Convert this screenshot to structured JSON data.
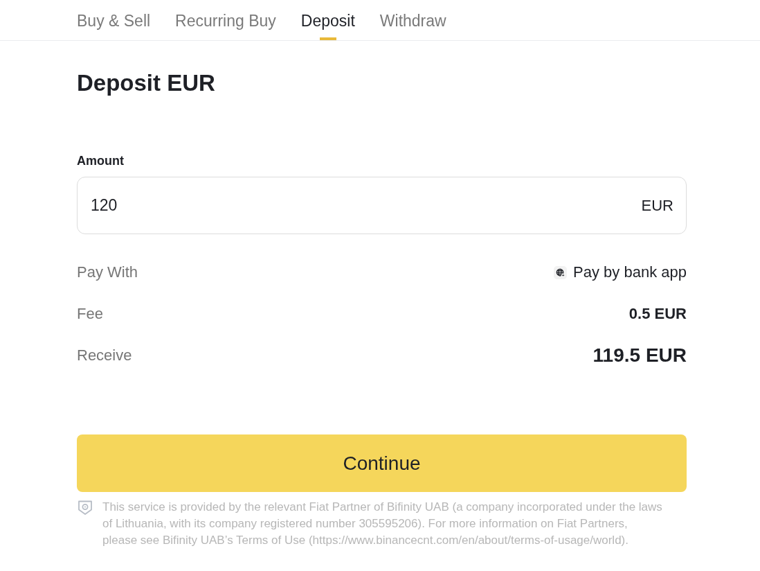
{
  "tabs": [
    {
      "label": "Buy & Sell",
      "selected": false
    },
    {
      "label": "Recurring Buy",
      "selected": false
    },
    {
      "label": "Deposit",
      "selected": true
    },
    {
      "label": "Withdraw",
      "selected": false
    }
  ],
  "title": "Deposit EUR",
  "amount": {
    "label": "Amount",
    "value": "120",
    "currency": "EUR"
  },
  "details": [
    {
      "kind": "method",
      "label": "Pay With",
      "value": "Pay by bank app"
    },
    {
      "kind": "plain",
      "label": "Fee",
      "value": "0.5 EUR"
    },
    {
      "kind": "total",
      "label": "Receive",
      "value": "119.5 EUR"
    }
  ],
  "continue_button": "Continue",
  "disclaimer": "This service is provided by the relevant Fiat Partner of Bifinity UAB (a company incorporated under the laws of Lithuania, with its company registered number 305595206). For more information on Fiat Partners, please see Bifinity UAB’s Terms of Use (https://www.binancecnt.com/en/about/terms-of-usage/world)."
}
